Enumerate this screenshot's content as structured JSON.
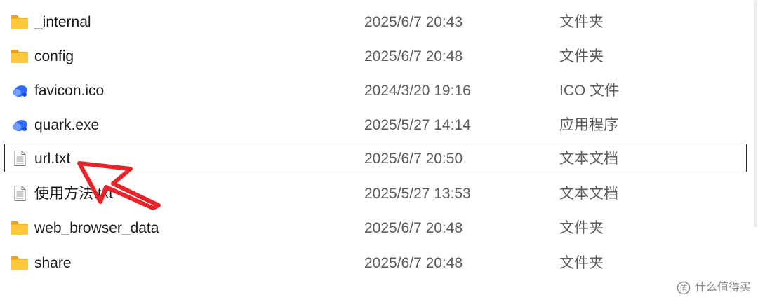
{
  "files": [
    {
      "name": "_internal",
      "date": "2025/6/7 20:43",
      "type": "文件夹",
      "icon": "folder-icon"
    },
    {
      "name": "config",
      "date": "2025/6/7 20:48",
      "type": "文件夹",
      "icon": "folder-icon"
    },
    {
      "name": "favicon.ico",
      "date": "2024/3/20 19:16",
      "type": "ICO 文件",
      "icon": "quark-icon"
    },
    {
      "name": "quark.exe",
      "date": "2025/5/27 14:14",
      "type": "应用程序",
      "icon": "quark-icon"
    },
    {
      "name": "url.txt",
      "date": "2025/6/7 20:50",
      "type": "文本文档",
      "icon": "text-file-icon",
      "selected": true
    },
    {
      "name": "使用方法.txt",
      "date": "2025/5/27 13:53",
      "type": "文本文档",
      "icon": "text-file-icon"
    },
    {
      "name": "web_browser_data",
      "date": "2025/6/7 20:48",
      "type": "文件夹",
      "icon": "folder-icon"
    },
    {
      "name": "share",
      "date": "2025/6/7 20:48",
      "type": "文件夹",
      "icon": "folder-icon"
    }
  ],
  "watermark": {
    "text": "什么值得买"
  },
  "colors": {
    "folder": "#FFC83D",
    "folder_dark": "#E8A317",
    "quark_blue": "#2F6BFF",
    "arrow_red": "#E8232A",
    "selection_border": "#2B2B2B"
  }
}
